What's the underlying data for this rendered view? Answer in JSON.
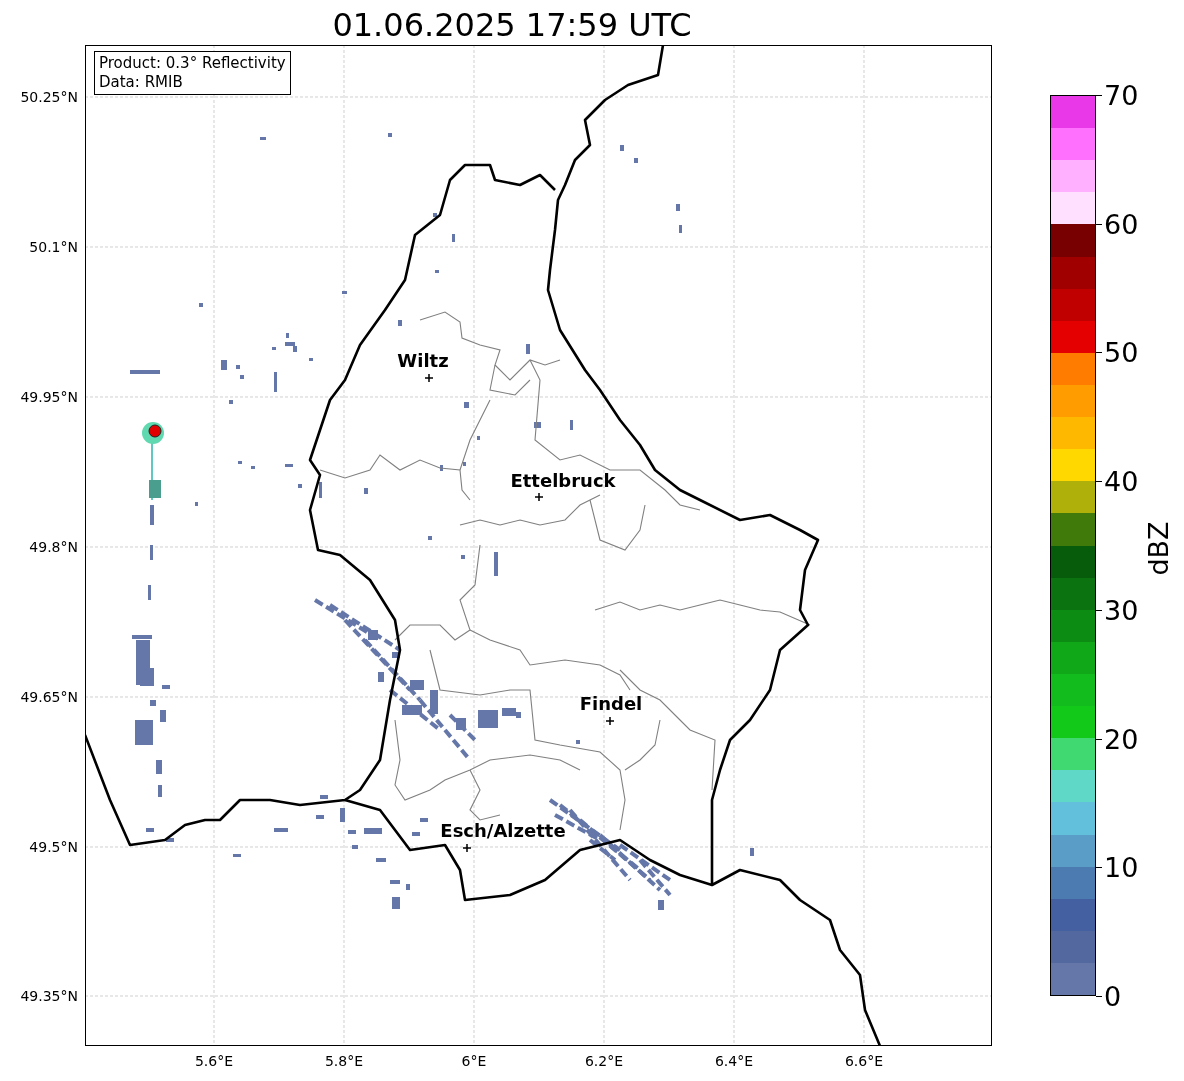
{
  "title": "01.06.2025 17:59 UTC",
  "info_box": {
    "lines": [
      "Product: 0.3° Reflectivity",
      "Data: RMIB"
    ]
  },
  "map": {
    "lat_ticks": [
      "50.25°N",
      "50.1°N",
      "49.95°N",
      "49.8°N",
      "49.65°N",
      "49.5°N",
      "49.35°N"
    ],
    "lon_ticks": [
      "5.6°E",
      "5.8°E",
      "6°E",
      "6.2°E",
      "6.4°E",
      "6.6°E"
    ],
    "cities": [
      {
        "name": "Wiltz"
      },
      {
        "name": "Ettelbruck"
      },
      {
        "name": "Findel"
      },
      {
        "name": "Esch/Alzette"
      }
    ]
  },
  "colorbar": {
    "label": "dBZ",
    "ticks": [
      "70",
      "60",
      "50",
      "40",
      "30",
      "20",
      "10",
      "0"
    ],
    "bands": [
      {
        "color": "#e838e8"
      },
      {
        "color": "#ff70ff"
      },
      {
        "color": "#ffb0ff"
      },
      {
        "color": "#ffe0ff"
      },
      {
        "color": "#780000"
      },
      {
        "color": "#a00000"
      },
      {
        "color": "#c00000"
      },
      {
        "color": "#e40000"
      },
      {
        "color": "#ff7c00"
      },
      {
        "color": "#ff9c00"
      },
      {
        "color": "#ffb800"
      },
      {
        "color": "#ffd800"
      },
      {
        "color": "#b0b00a"
      },
      {
        "color": "#3f7a0a"
      },
      {
        "color": "#075c0c"
      },
      {
        "color": "#0b7410"
      },
      {
        "color": "#0d8c14"
      },
      {
        "color": "#10a818"
      },
      {
        "color": "#12bc1c"
      },
      {
        "color": "#12c818"
      },
      {
        "color": "#40d870"
      },
      {
        "color": "#60d8c8"
      },
      {
        "color": "#62c0dc"
      },
      {
        "color": "#5a9ec8"
      },
      {
        "color": "#4b7bb0"
      },
      {
        "color": "#4560a0"
      },
      {
        "color": "#5468a0"
      },
      {
        "color": "#6577a8"
      }
    ]
  }
}
